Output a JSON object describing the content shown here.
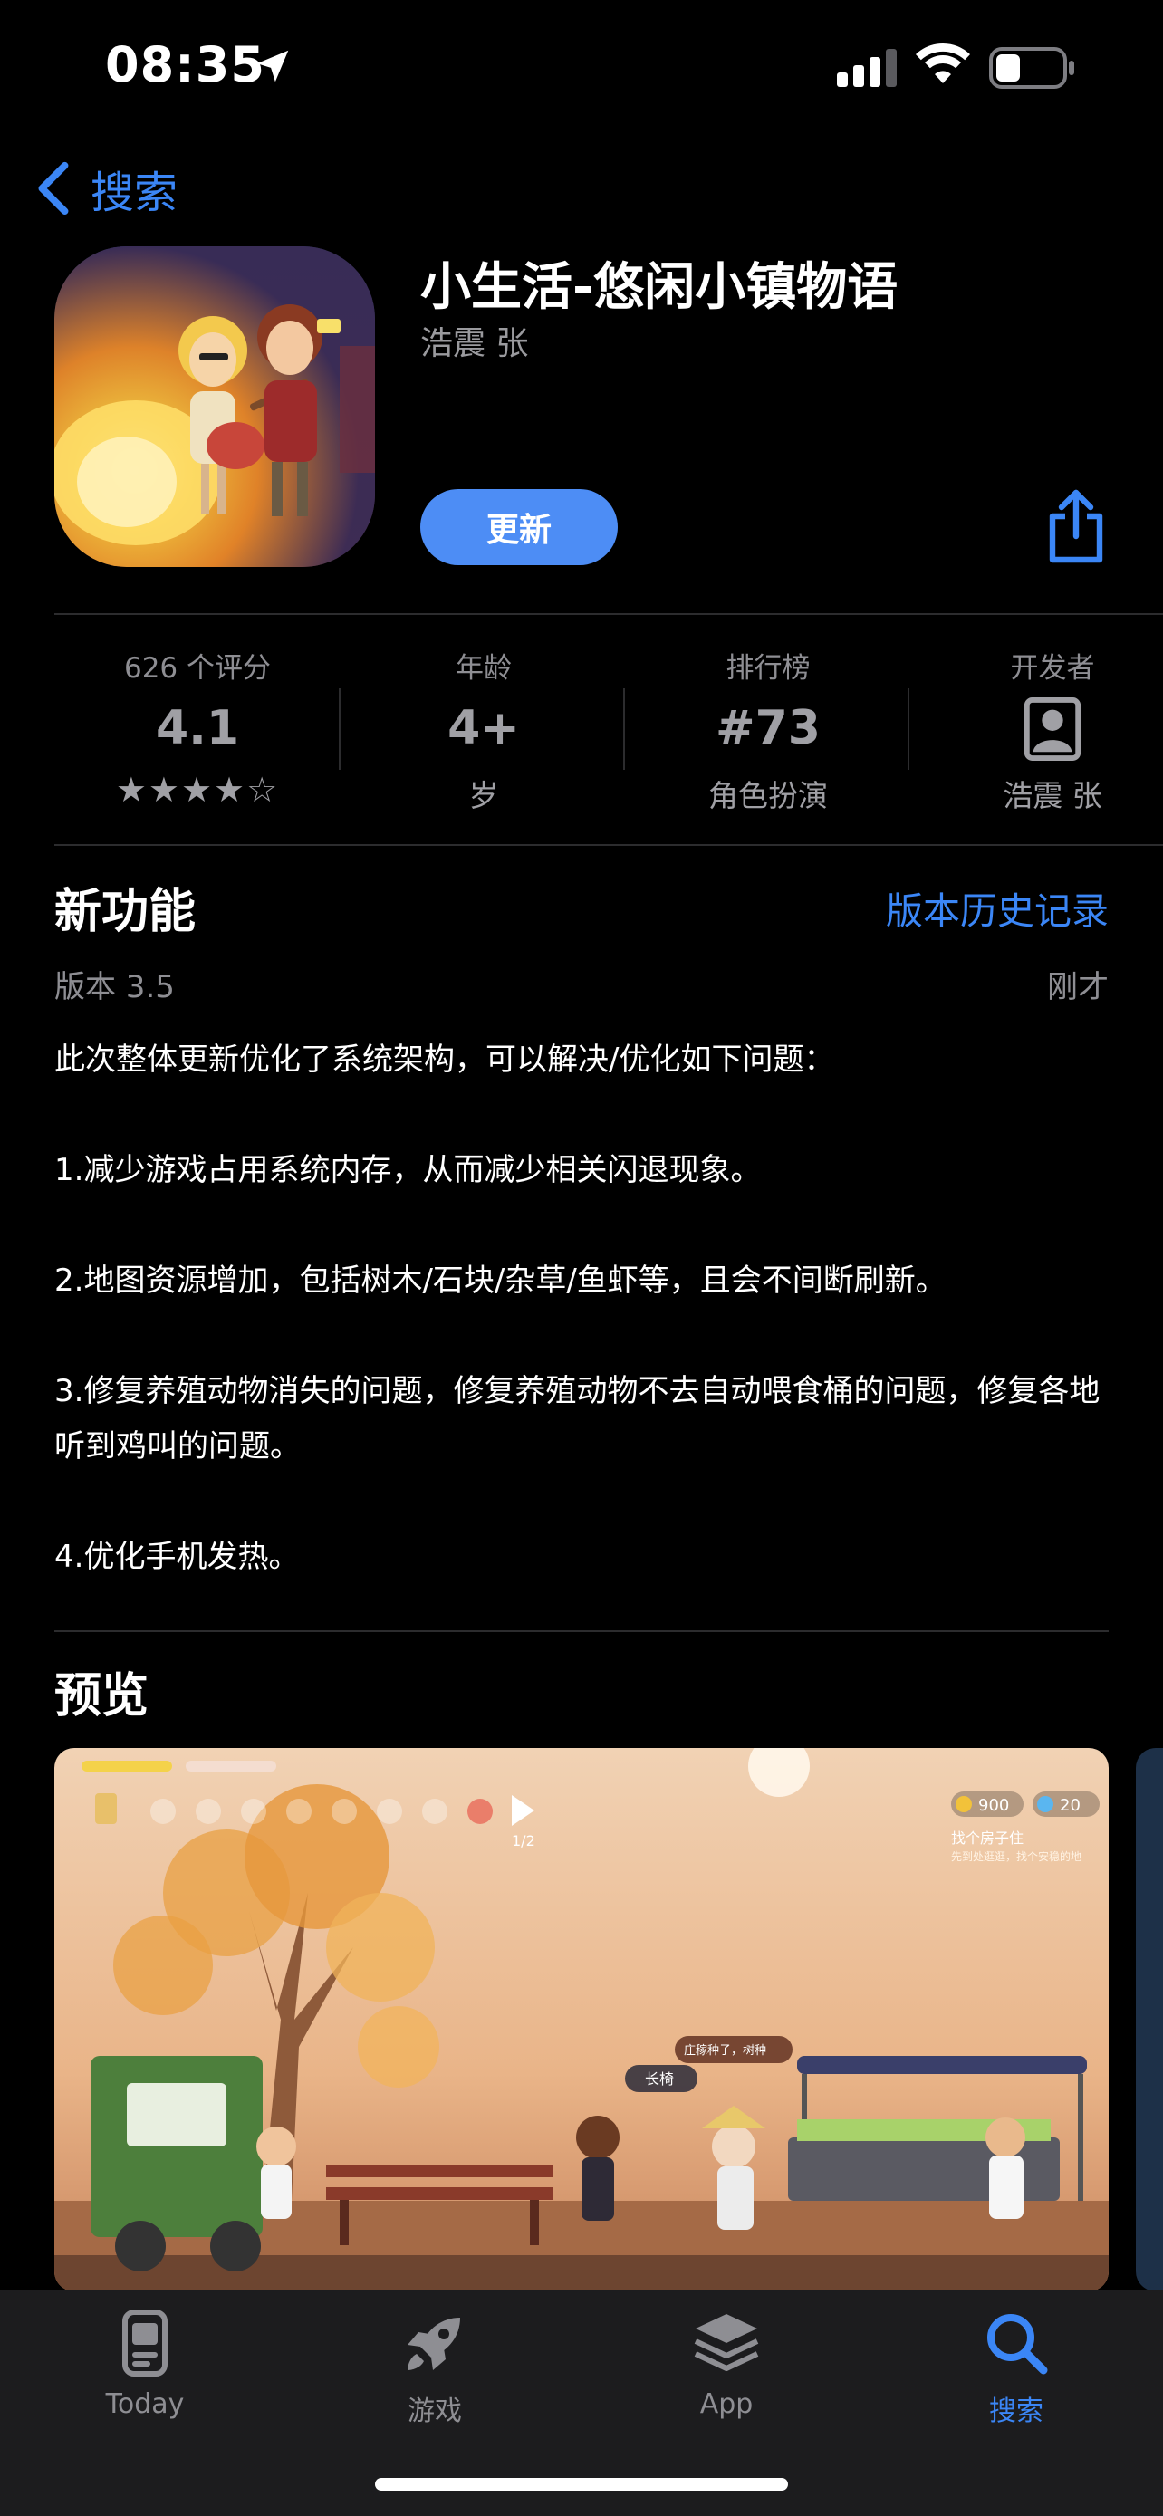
{
  "status_bar": {
    "time": "08:35"
  },
  "nav": {
    "back_label": "搜索"
  },
  "app": {
    "title": "小生活-悠闲小镇物语",
    "developer": "浩震 张",
    "update_label": "更新"
  },
  "info": {
    "ratings_label": "626 个评分",
    "rating_value": "4.1",
    "rating_stars": "★★★★☆",
    "rating": 4.1,
    "age_label": "年龄",
    "age_value": "4+",
    "age_sub": "岁",
    "chart_label": "排行榜",
    "chart_value": "#73",
    "chart_sub": "角色扮演",
    "developer_label": "开发者",
    "developer_name": "浩震 张"
  },
  "whats_new": {
    "title": "新功能",
    "history_link": "版本历史记录",
    "version": "版本 3.5",
    "when": "刚才",
    "notes": [
      "此次整体更新优化了系统架构，可以解决/优化如下问题：",
      "1.减少游戏占用系统内存，从而减少相关闪退现象。",
      "2.地图资源增加，包括树木/石块/杂草/鱼虾等，且会不间断刷新。",
      "3.修复养殖动物消失的问题，修复养殖动物不去自动喂食桶的问题，修复各地听到鸡叫的问题。",
      "4.优化手机发热。"
    ]
  },
  "preview": {
    "title": "预览",
    "coins": "900",
    "gems": "20",
    "quest_title": "找个房子住",
    "quest_desc": "先到处逛逛，找个安稳的地",
    "page_indicator": "1/2",
    "bubble_text": "长椅",
    "sign_text": "庄稼种子，树种"
  },
  "tab_bar": {
    "items": [
      {
        "label": "Today",
        "icon": "today-icon"
      },
      {
        "label": "游戏",
        "icon": "rocket-icon"
      },
      {
        "label": "App",
        "icon": "layers-icon"
      },
      {
        "label": "搜索",
        "icon": "search-icon"
      }
    ],
    "active": "搜索"
  },
  "colors": {
    "accent": "#3b86f6",
    "background": "#000000",
    "secondary_text": "#8e8e93"
  }
}
